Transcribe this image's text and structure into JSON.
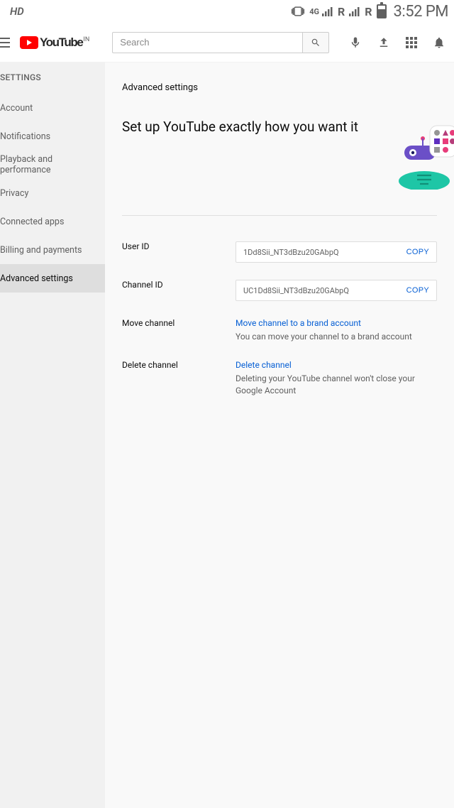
{
  "status_bar": {
    "hd": "HD",
    "net_badge_4g": "4G",
    "roaming": "R",
    "clock": "3:52 PM"
  },
  "header": {
    "brand_name": "YouTube",
    "region": "IN",
    "search_placeholder": "Search"
  },
  "sidebar": {
    "heading": "SETTINGS",
    "items": [
      {
        "label": "Account"
      },
      {
        "label": "Notifications"
      },
      {
        "label": "Playback and performance"
      },
      {
        "label": "Privacy"
      },
      {
        "label": "Connected apps"
      },
      {
        "label": "Billing and payments"
      },
      {
        "label": "Advanced settings"
      }
    ],
    "active_index": 6
  },
  "main": {
    "title": "Advanced settings",
    "subtitle": "Set up YouTube exactly how you want it",
    "user_id": {
      "label": "User ID",
      "value": "1Dd8Sii_NT3dBzu20GAbpQ",
      "copy": "COPY"
    },
    "channel_id": {
      "label": "Channel ID",
      "value": "UC1Dd8Sii_NT3dBzu20GAbpQ",
      "copy": "COPY"
    },
    "move_channel": {
      "label": "Move channel",
      "link": "Move channel to a brand account",
      "desc": "You can move your channel to a brand account"
    },
    "delete_channel": {
      "label": "Delete channel",
      "link": "Delete channel",
      "desc": "Deleting your YouTube channel won't close your Google Account"
    }
  }
}
